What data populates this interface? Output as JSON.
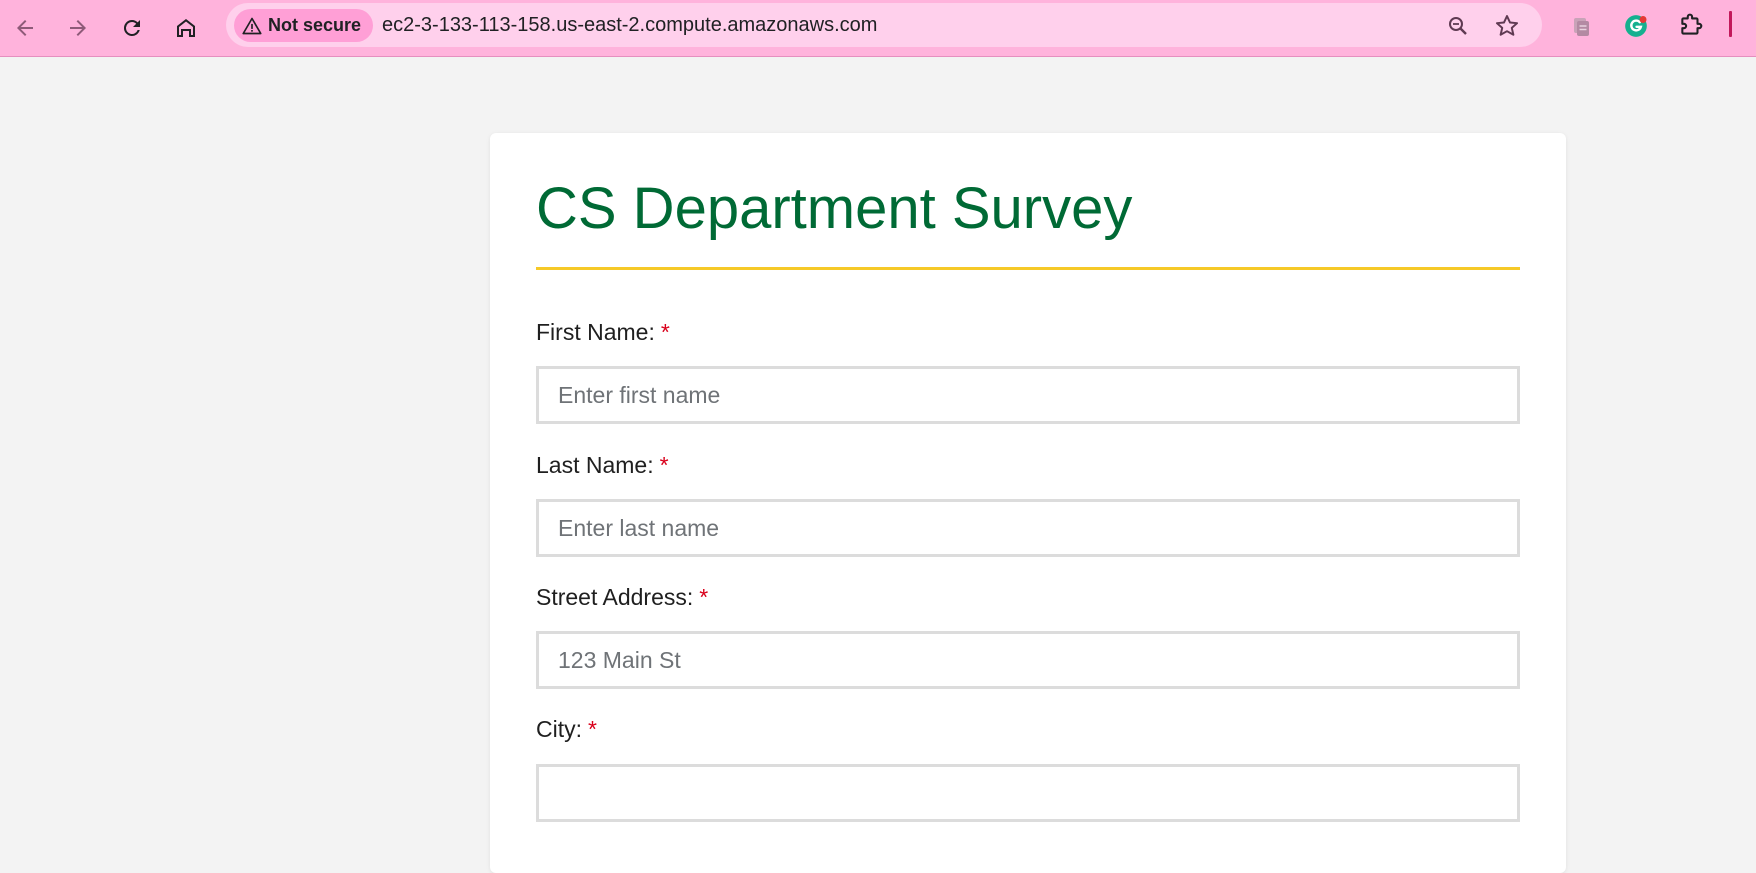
{
  "browser": {
    "security_chip": "Not secure",
    "url": "ec2-3-133-113-158.us-east-2.compute.amazonaws.com",
    "icons": [
      "back-icon",
      "forward-icon",
      "reload-icon",
      "home-icon",
      "warning-icon",
      "zoom-icon",
      "bookmark-star-icon",
      "clipboard-extension-icon",
      "grammarly-extension-icon",
      "extensions-puzzle-icon"
    ],
    "toolbar_color": "#ffb3dc"
  },
  "form": {
    "title": "CS Department Survey",
    "title_color": "#006a35",
    "rule_color": "#f6c928",
    "required_marker": "*",
    "fields": [
      {
        "label": "First Name:",
        "placeholder": "Enter first name",
        "value": ""
      },
      {
        "label": "Last Name:",
        "placeholder": "Enter last name",
        "value": ""
      },
      {
        "label": "Street Address:",
        "placeholder": "123 Main St",
        "value": ""
      },
      {
        "label": "City:",
        "placeholder": "",
        "value": ""
      }
    ]
  }
}
